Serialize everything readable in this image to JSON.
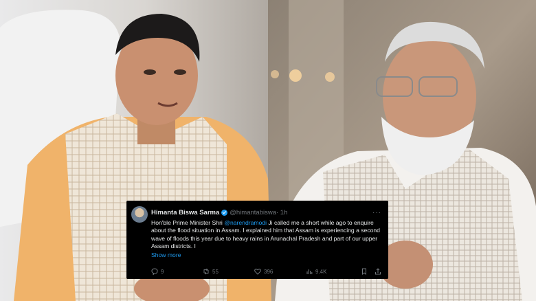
{
  "tweet": {
    "name": "Himanta Biswa Sarma",
    "handle": "@himantabiswa",
    "time": "· 1h",
    "text_1": "Hon'ble Prime Minister Shri ",
    "mention": "@narendramodi",
    "text_2": " Ji called me a short while ago to enquire about the flood situation in Assam. I explained him that Assam is experiencing a second wave of floods this year due to heavy rains in Arunachal Pradesh and part of our upper Assam districts. I",
    "show_more": "Show more",
    "replies": "9",
    "reposts": "55",
    "likes": "396",
    "views": "9.4K"
  },
  "icons": [
    "more-icon",
    "verified-icon",
    "reply-icon",
    "repost-icon",
    "like-icon",
    "views-icon",
    "bookmark-icon",
    "share-icon"
  ],
  "colors": {
    "link": "#1d9bf0",
    "card_bg": "#000000",
    "muted": "#71767b"
  }
}
